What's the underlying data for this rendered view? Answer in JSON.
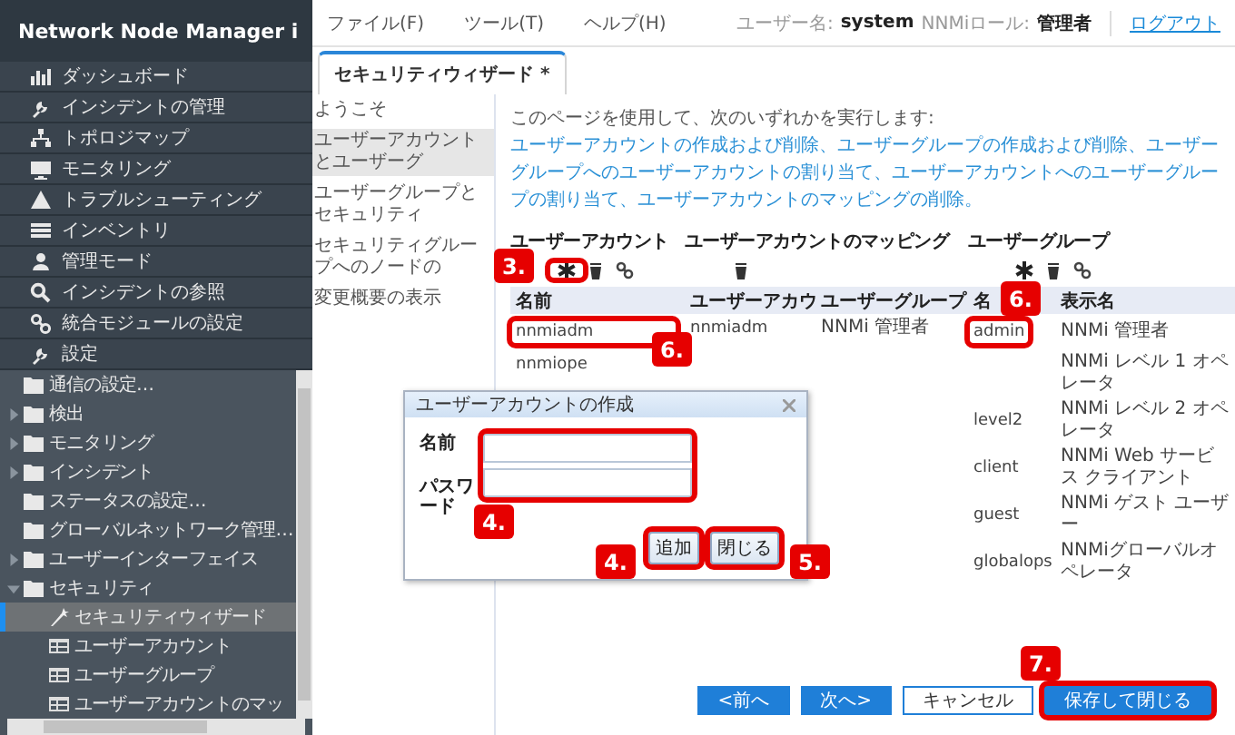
{
  "sidebar": {
    "title": "Network Node Manager i",
    "items": [
      {
        "label": "ダッシュボード"
      },
      {
        "label": "インシデントの管理"
      },
      {
        "label": "トポロジマップ"
      },
      {
        "label": "モニタリング"
      },
      {
        "label": "トラブルシューティング"
      },
      {
        "label": "インベントリ"
      },
      {
        "label": "管理モード"
      },
      {
        "label": "インシデントの参照"
      },
      {
        "label": "統合モジュールの設定"
      },
      {
        "label": "設定",
        "children": [
          {
            "label": "通信の設定…",
            "kind": "folder",
            "expandable": false,
            "expanded": false,
            "selected": false
          },
          {
            "label": "検出",
            "kind": "folder",
            "expandable": true,
            "expanded": false,
            "selected": false
          },
          {
            "label": "モニタリング",
            "kind": "folder",
            "expandable": true,
            "expanded": false,
            "selected": false
          },
          {
            "label": "インシデント",
            "kind": "folder",
            "expandable": true,
            "expanded": false,
            "selected": false
          },
          {
            "label": "ステータスの設定…",
            "kind": "folder",
            "expandable": false,
            "expanded": false,
            "selected": false
          },
          {
            "label": "グローバルネットワーク管理…",
            "kind": "folder",
            "expandable": false,
            "expanded": false,
            "selected": false
          },
          {
            "label": "ユーザーインターフェイス",
            "kind": "folder",
            "expandable": true,
            "expanded": false,
            "selected": false
          },
          {
            "label": "セキュリティ",
            "kind": "folder",
            "expandable": true,
            "expanded": true,
            "selected": false,
            "children": [
              {
                "label": "セキュリティウィザード",
                "kind": "wizard",
                "expandable": false,
                "expanded": false,
                "selected": true
              },
              {
                "label": "ユーザーアカウント",
                "kind": "table",
                "expandable": false,
                "expanded": false,
                "selected": false
              },
              {
                "label": "ユーザーグループ",
                "kind": "table",
                "expandable": false,
                "expanded": false,
                "selected": false
              },
              {
                "label": "ユーザーアカウントのマッ",
                "kind": "table",
                "expandable": false,
                "expanded": false,
                "selected": false
              }
            ]
          }
        ]
      }
    ]
  },
  "menubar": [
    "ファイル(F)",
    "ツール(T)",
    "ヘルプ(H)"
  ],
  "user_info": {
    "user_label": "ユーザー名:",
    "user": "system",
    "role_label": "NNMiロール:",
    "role": "管理者",
    "logout": "ログアウト"
  },
  "tabs": [
    {
      "label": "セキュリティウィザード *",
      "selected": true
    }
  ],
  "wizard_nav": [
    {
      "label": "ようこそ",
      "selected": false
    },
    {
      "label": "ユーザーアカウントとユーザーグ",
      "selected": true
    },
    {
      "label": "ユーザーグループとセキュリティ",
      "selected": false
    },
    {
      "label": "セキュリティグループへのノードの",
      "selected": false
    },
    {
      "label": "変更概要の表示",
      "selected": false
    }
  ],
  "intro": {
    "text": "このページを使用して、次のいずれかを実行します:",
    "tasks": "ユーザーアカウントの作成および削除、ユーザーグループの作成および削除、ユーザーグループへのユーザーアカウントの割り当て、ユーザーアカウントへのユーザーグループの割り当て、ユーザーアカウントのマッピングの削除。"
  },
  "panels": [
    {
      "title": "ユーザーアカウント",
      "tools": [
        {
          "kind": "add"
        },
        {
          "kind": "delete"
        },
        {
          "kind": "assign"
        }
      ],
      "columns": [
        "名前"
      ],
      "rows": [
        [
          "nnmiadm"
        ],
        [
          "nnmiope"
        ]
      ]
    },
    {
      "title": "ユーザーアカウントのマッピング",
      "tools": [
        {
          "kind": "delete"
        }
      ],
      "columns": [
        "ユーザーアカウ",
        "ユーザーグループ"
      ],
      "rows": [
        [
          "nnmiadm",
          "NNMi 管理者"
        ]
      ]
    },
    {
      "title": "ユーザーグループ",
      "tools": [
        {
          "kind": "add"
        },
        {
          "kind": "delete"
        },
        {
          "kind": "assign"
        }
      ],
      "columns": [
        "名",
        "表示名"
      ],
      "rows": [
        [
          "admin",
          "NNMi 管理者"
        ],
        [
          null,
          "NNMi レベル 1 オペレータ"
        ],
        [
          "level2",
          "NNMi レベル 2 オペレータ"
        ],
        [
          "client",
          "NNMi Web サービス クライアント"
        ],
        [
          "guest",
          "NNMi ゲスト ユーザー"
        ],
        [
          "globalops",
          "NNMiグローバルオペレータ"
        ]
      ]
    }
  ],
  "dialog": {
    "title": "ユーザーアカウントの作成",
    "fields": [
      {
        "label": "名前"
      },
      {
        "label": "パスワード"
      }
    ],
    "buttons": [
      "追加",
      "閉じる"
    ]
  },
  "footer": [
    {
      "label": "<前へ",
      "kind": "primary"
    },
    {
      "label": "次へ>",
      "kind": "primary"
    },
    {
      "label": "キャンセル",
      "kind": "secondary"
    },
    {
      "label": "保存して閉じる",
      "kind": "primary"
    }
  ],
  "annotations": [
    {
      "text": "3."
    },
    {
      "text": "6."
    },
    {
      "text": "6."
    },
    {
      "text": "4."
    },
    {
      "text": "4."
    },
    {
      "text": "5."
    },
    {
      "text": "7."
    }
  ]
}
